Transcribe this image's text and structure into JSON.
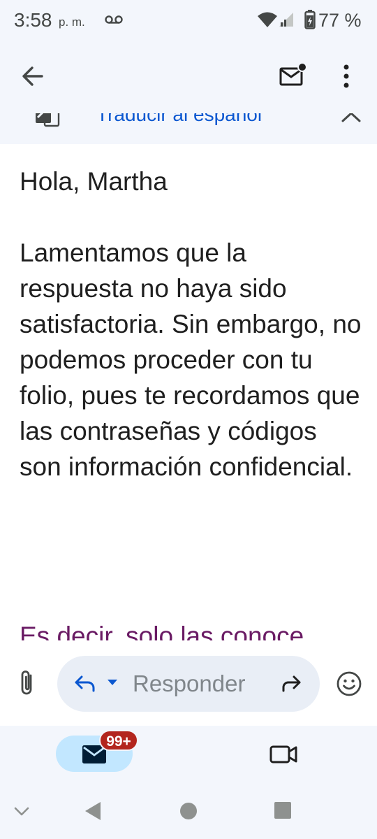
{
  "status_bar": {
    "time": "3:58",
    "ampm": "p. m.",
    "battery_percent": "77 %",
    "icons": [
      "voicemail-icon",
      "wifi-icon",
      "signal-icon",
      "battery-charging-icon"
    ]
  },
  "app_bar": {
    "icons": [
      "arrow-back-icon",
      "mark-unread-icon",
      "more-vert-icon"
    ]
  },
  "translation": {
    "label": "Traducir al español",
    "icons": [
      "translate-icon",
      "chevron-up-icon"
    ]
  },
  "email": {
    "greeting": "Hola, Martha",
    "paragraph": "Lamentamos que la respuesta no haya sido satisfactoria. Sin embargo, no podemos proceder con tu folio, pues te recordamos que las contraseñas y códigos son información confidencial.",
    "tail": "Es decir, solo las conoce"
  },
  "reply_bar": {
    "placeholder": "Responder",
    "icons": [
      "attach-icon",
      "reply-icon",
      "dropdown-icon",
      "forward-icon",
      "emoji-icon"
    ]
  },
  "bottom_nav": {
    "mail_badge": "99+",
    "icons": [
      "mail-icon",
      "video-call-icon"
    ]
  },
  "system_nav": {
    "icons": [
      "chevron-down-icon",
      "back-triangle-icon",
      "home-circle-icon",
      "recents-square-icon"
    ]
  },
  "colors": {
    "surface": "#f3f6fc",
    "link": "#0b57d0",
    "tail_text": "#6a1b64",
    "reply_pill": "#e9eef6",
    "active_tab": "#c2e7ff",
    "badge": "#b3261e"
  }
}
